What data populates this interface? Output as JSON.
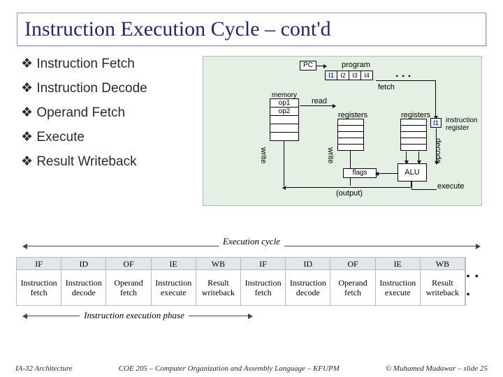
{
  "title": "Instruction Execution Cycle – cont'd",
  "bullets": [
    "Instruction Fetch",
    "Instruction Decode",
    "Operand Fetch",
    "Execute",
    "Result Writeback"
  ],
  "diagram": {
    "pc": "PC",
    "program_label": "program",
    "instructions": [
      "I1",
      "I2",
      "I3",
      "I4"
    ],
    "ellipsis": ". . .",
    "fetch": "fetch",
    "memory_label": "memory",
    "op1": "op1",
    "op2": "op2",
    "read": "read",
    "registers_label": "registers",
    "write": "write",
    "flags": "flags",
    "alu": "ALU",
    "execute": "execute",
    "output": "(output)",
    "ir": "I1",
    "ir_label": "instruction register",
    "decode": "decode"
  },
  "timeline": {
    "top_caption": "Execution cycle",
    "headers": [
      "IF",
      "ID",
      "OF",
      "IE",
      "WB",
      "IF",
      "ID",
      "OF",
      "IE",
      "WB"
    ],
    "rows": [
      "Instruction fetch",
      "Instruction decode",
      "Operand fetch",
      "Instruction execute",
      "Result writeback",
      "Instruction fetch",
      "Instruction decode",
      "Operand fetch",
      "Instruction execute",
      "Result writeback"
    ],
    "more": ". . .",
    "bottom_caption": "Instruction execution phase"
  },
  "footer": {
    "left": "IA-32 Architecture",
    "center": "COE 205 – Computer Organization and Assembly Language – KFUPM",
    "right": "© Muhamed Mudawar – slide 25"
  }
}
